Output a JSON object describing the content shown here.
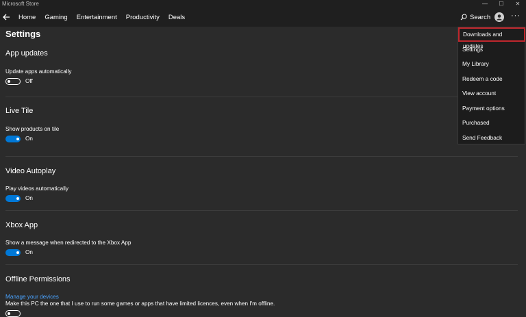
{
  "window": {
    "title": "Microsoft Store",
    "controls": [
      "—",
      "☐",
      "✕"
    ]
  },
  "nav": {
    "links": [
      "Home",
      "Gaming",
      "Entertainment",
      "Productivity",
      "Deals"
    ],
    "search_label": "Search",
    "more_label": "···"
  },
  "page": {
    "title": "Settings"
  },
  "sections": {
    "app_updates": {
      "heading": "App updates",
      "label": "Update apps automatically",
      "state": "Off"
    },
    "live_tile": {
      "heading": "Live Tile",
      "label": "Show products on tile",
      "state": "On"
    },
    "video_autoplay": {
      "heading": "Video Autoplay",
      "label": "Play videos automatically",
      "state": "On"
    },
    "xbox_app": {
      "heading": "Xbox App",
      "label": "Show a message when redirected to the Xbox App",
      "state": "On"
    },
    "offline": {
      "heading": "Offline Permissions",
      "link": "Manage your devices",
      "description": "Make this PC the one that I use to run some games or apps that have limited licences, even when I'm offline."
    }
  },
  "menu": {
    "items": [
      "Downloads and updates",
      "Settings",
      "My Library",
      "Redeem a code",
      "View account",
      "Payment options",
      "Purchased",
      "Send Feedback"
    ],
    "highlighted_index": 0,
    "highlight_color": "#c0272d"
  },
  "colors": {
    "accent": "#0078d7",
    "link": "#4aa3ff",
    "background": "#2b2b2b"
  }
}
